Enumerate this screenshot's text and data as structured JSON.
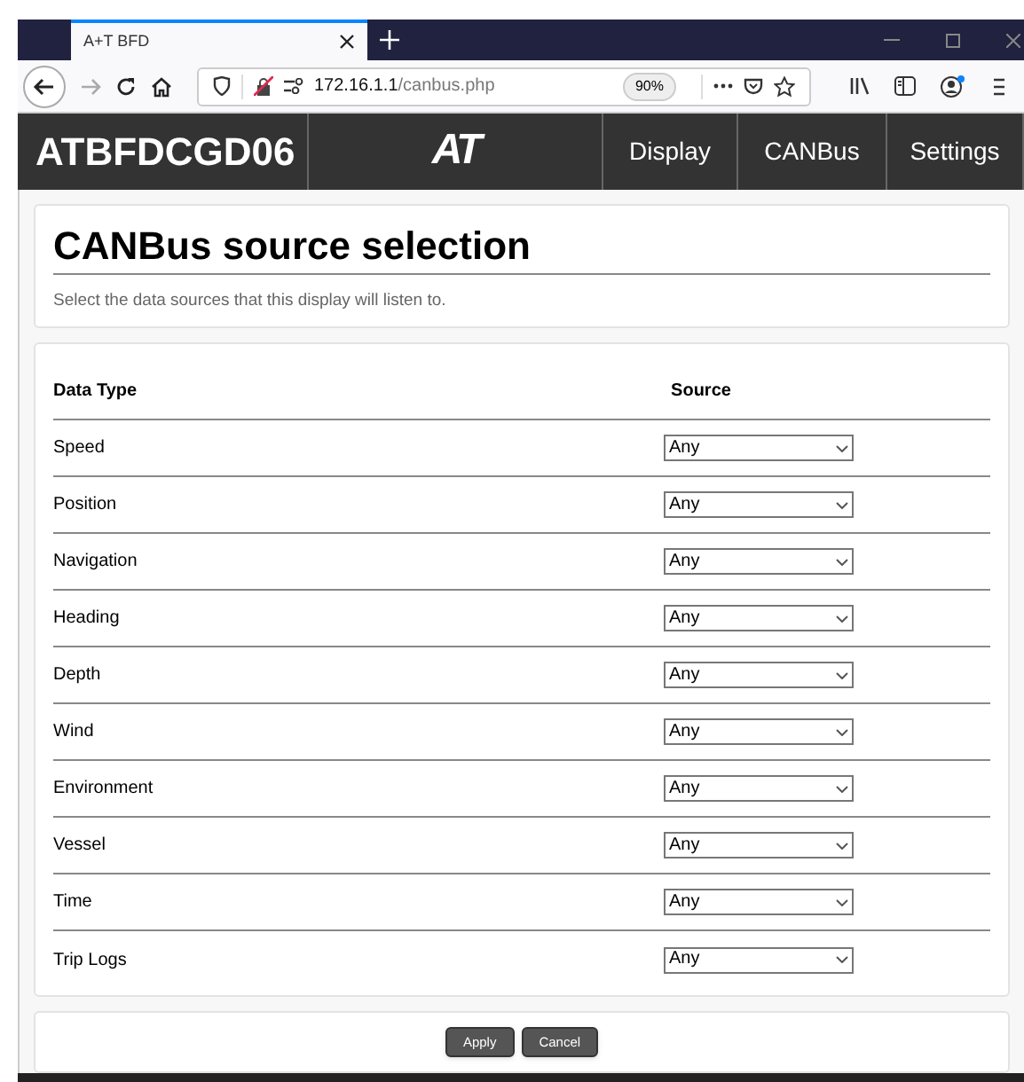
{
  "browser": {
    "tab_title": "A+T BFD",
    "url_host": "172.16.1.1",
    "url_path": "/canbus.php",
    "zoom": "90%"
  },
  "header": {
    "device_name": "ATBFDCGD06",
    "logo": "AT",
    "nav": [
      "Display",
      "CANBus",
      "Settings"
    ]
  },
  "page": {
    "title": "CANBus source selection",
    "subtitle": "Select the data sources that this display will listen to."
  },
  "table": {
    "columns": [
      "Data Type",
      "Source"
    ],
    "rows": [
      {
        "data_type": "Speed",
        "source": "Any"
      },
      {
        "data_type": "Position",
        "source": "Any"
      },
      {
        "data_type": "Navigation",
        "source": "Any"
      },
      {
        "data_type": "Heading",
        "source": "Any"
      },
      {
        "data_type": "Depth",
        "source": "Any"
      },
      {
        "data_type": "Wind",
        "source": "Any"
      },
      {
        "data_type": "Environment",
        "source": "Any"
      },
      {
        "data_type": "Vessel",
        "source": "Any"
      },
      {
        "data_type": "Time",
        "source": "Any"
      },
      {
        "data_type": "Trip Logs",
        "source": "Any"
      }
    ]
  },
  "buttons": [
    "Apply",
    "Cancel"
  ]
}
